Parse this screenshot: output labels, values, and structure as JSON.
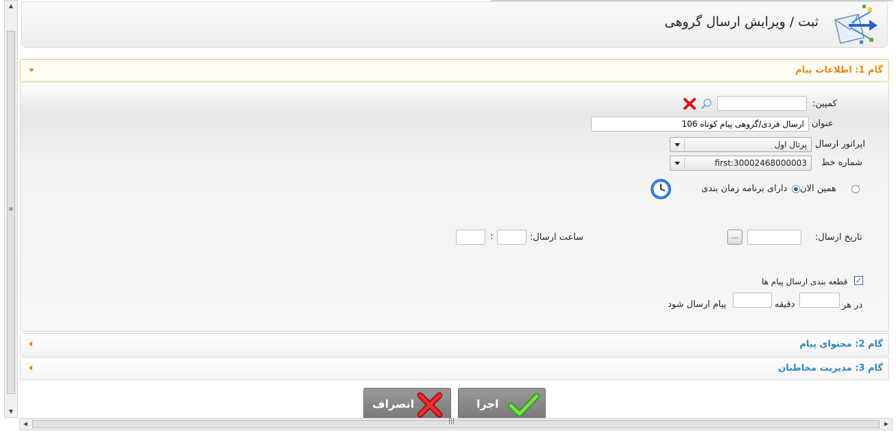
{
  "header": {
    "title": "ثبت / ویرایش ارسال گروهی",
    "icon": "group-send-envelope-icon"
  },
  "steps": [
    {
      "label": "گام 1: اطلاعات پیام",
      "state": "expanded",
      "color": "#e08a12"
    },
    {
      "label": "گام 2: محتوای پیام",
      "state": "collapsed",
      "color": "#2e86c1"
    },
    {
      "label": "گام 3: مدیریت مخاطبان",
      "state": "collapsed",
      "color": "#2e86c1"
    }
  ],
  "form": {
    "campaign_label": "کمپین:",
    "campaign_value": "",
    "title_label": "عنوان",
    "title_value": "ارسال فردی/گروهی پیام کوتاه 106",
    "operator_label": "اپراتور ارسال",
    "operator_value": "پرتال اول",
    "line_label": "شماره خط",
    "line_value": "first:30002468000003",
    "radio_now": "همین الان",
    "radio_scheduled": "دارای برنامه زمان بندی",
    "schedule_mode": "scheduled",
    "send_date_label": "تاریخ ارسال:",
    "send_date_value": "",
    "date_picker_label": "...",
    "send_time_label": "ساعت ارسال:",
    "time_separator": ":",
    "send_hour_value": "",
    "send_minute_value": "",
    "batch_checkbox_label": "قطعه بندی ارسال پیام ها",
    "batch_checked": true,
    "every_label": "در هر",
    "minutes_label": "دقیقه",
    "messages_label": "پیام ارسال شود",
    "every_minutes_value": "",
    "messages_count_value": ""
  },
  "actions": {
    "execute_label": "اجرا",
    "cancel_label": "انصراف"
  }
}
